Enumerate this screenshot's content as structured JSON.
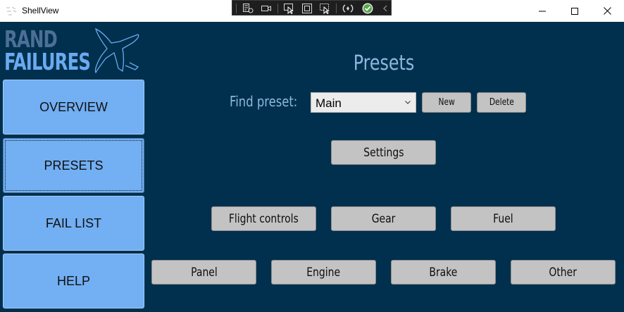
{
  "window": {
    "title": "ShellView",
    "minimize_icon": "minimize-icon",
    "maximize_icon": "maximize-icon",
    "close_icon": "close-icon"
  },
  "debug_toolbar": {
    "icons": [
      "live-visual-tree-icon",
      "record-icon",
      "select-element-icon",
      "display-layout-adorners-icon",
      "track-focus-icon",
      "hot-reload-icon",
      "binding-check-icon",
      "collapse-icon"
    ]
  },
  "logo": {
    "line1": "RAND",
    "line2": "FAILURES",
    "icon": "airplane-icon"
  },
  "nav": {
    "overview": "OVERVIEW",
    "presets": "PRESETS",
    "fail_list": "FAIL LIST",
    "help": "HELP",
    "active": "PRESETS"
  },
  "page": {
    "title": "Presets",
    "find_label": "Find preset:",
    "preset_selected": "Main",
    "new_label": "New",
    "delete_label": "Delete",
    "settings_label": "Settings",
    "categories": [
      "Flight controls",
      "Gear",
      "Fuel",
      "Panel",
      "Engine",
      "Brake",
      "Other"
    ]
  },
  "colors": {
    "background": "#00304d",
    "nav_button": "#72aff3",
    "heading_text": "#8fb6df",
    "gray_button": "#c3c3c3"
  }
}
